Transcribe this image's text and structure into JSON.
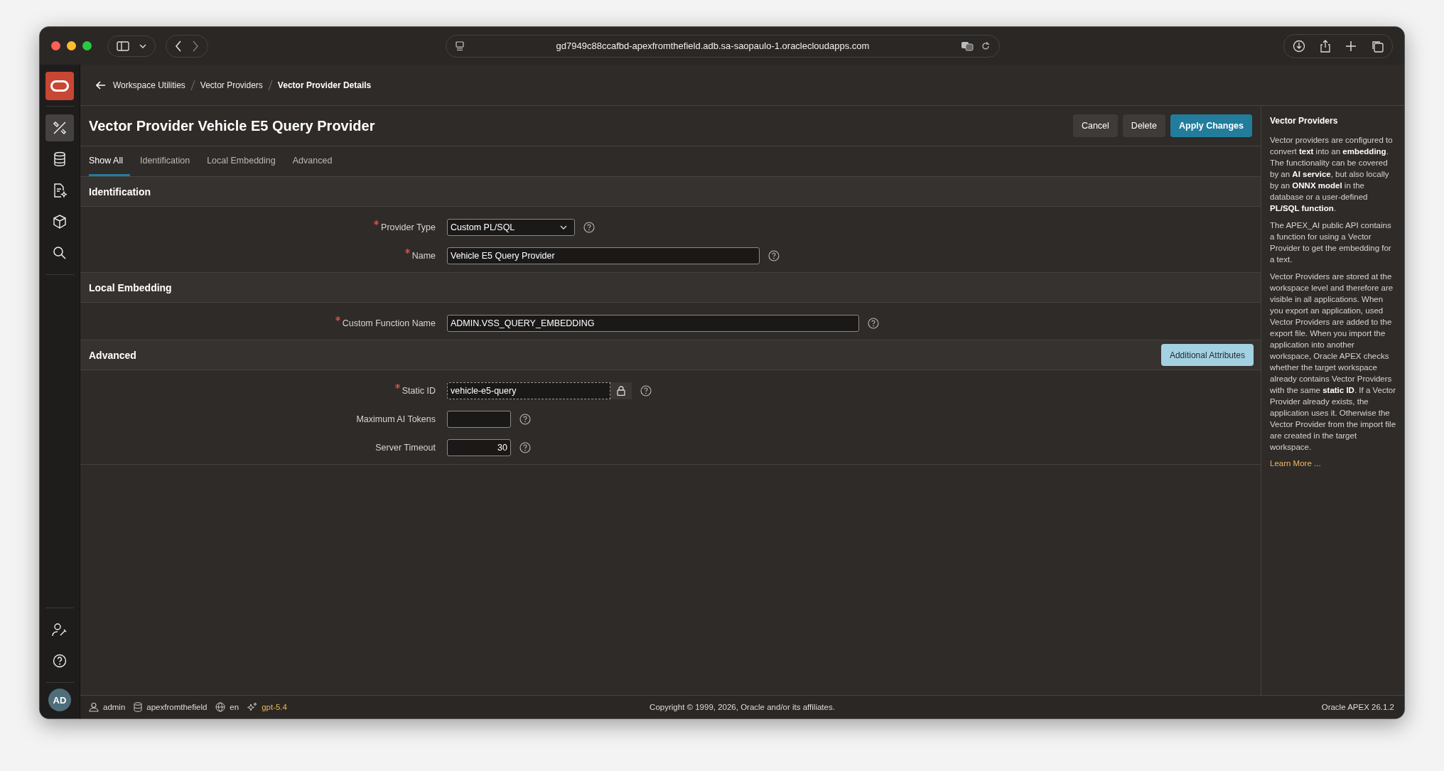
{
  "browser": {
    "url": "gd7949c88ccafbd-apexfromthefield.adb.sa-saopaulo-1.oraclecloudapps.com"
  },
  "sidebar": {
    "items": [
      {
        "kind": "tools",
        "selected": true
      },
      {
        "kind": "database",
        "selected": false
      },
      {
        "kind": "document",
        "selected": false
      },
      {
        "kind": "package",
        "selected": false
      },
      {
        "kind": "search",
        "selected": false
      }
    ],
    "bottom": [
      {
        "kind": "user-settings"
      },
      {
        "kind": "help"
      }
    ],
    "avatar": "AD"
  },
  "breadcrumb": [
    {
      "label": "Workspace Utilities",
      "current": false
    },
    {
      "label": "Vector Providers",
      "current": false
    },
    {
      "label": "Vector Provider Details",
      "current": true
    }
  ],
  "page": {
    "title": "Vector Provider Vehicle E5 Query Provider",
    "buttons": [
      {
        "label": "Cancel",
        "kind": "secondary"
      },
      {
        "label": "Delete",
        "kind": "secondary"
      },
      {
        "label": "Apply Changes",
        "kind": "primary"
      }
    ]
  },
  "tabs": [
    {
      "label": "Show All",
      "selected": true
    },
    {
      "label": "Identification",
      "selected": false
    },
    {
      "label": "Local Embedding",
      "selected": false
    },
    {
      "label": "Advanced",
      "selected": false
    }
  ],
  "sections": [
    {
      "title": "Identification",
      "fields": [
        {
          "label": "Provider Type",
          "required": true,
          "kind": "select",
          "value": "Custom PL/SQL"
        },
        {
          "label": "Name",
          "required": true,
          "kind": "text",
          "value": "Vehicle E5 Query Provider"
        }
      ]
    },
    {
      "title": "Local Embedding",
      "fields": [
        {
          "label": "Custom Function Name",
          "required": true,
          "kind": "longtext",
          "value": "ADMIN.VSS_QUERY_EMBEDDING"
        }
      ]
    },
    {
      "title": "Advanced",
      "action": "Additional Attributes",
      "fields": [
        {
          "label": "Static ID",
          "required": true,
          "kind": "locked",
          "value": "vehicle-e5-query"
        },
        {
          "label": "Maximum AI Tokens",
          "required": false,
          "kind": "number"
        },
        {
          "label": "Server Timeout",
          "required": false,
          "kind": "number",
          "value": "30"
        }
      ]
    }
  ],
  "help": {
    "title": "Vector Providers",
    "paragraphs": [
      "Vector providers are configured to convert **text** into an **embedding**. The functionality can be covered by an **AI service**, but also locally by an **ONNX model** in the database or a user-defined **PL/SQL function**.",
      "The APEX_AI public API contains a function for using a Vector Provider to get the embedding for a text.",
      "Vector Providers are stored at the workspace level and therefore are visible in all applications. When you export an application, used Vector Providers are added to the export file. When you import the application into another workspace, Oracle APEX checks whether the target workspace already contains Vector Providers with the same **static ID**. If a Vector Provider already exists, the application uses it. Otherwise the Vector Provider from the import file are created in the target workspace."
    ],
    "link": "Learn More ..."
  },
  "footer": {
    "user": "admin",
    "workspace": "apexfromthefield",
    "language": "en",
    "model": "gpt-5.4",
    "copyright": "Copyright © 1999, 2026, Oracle and/or its affiliates.",
    "version": "Oracle APEX 26.1.2"
  }
}
